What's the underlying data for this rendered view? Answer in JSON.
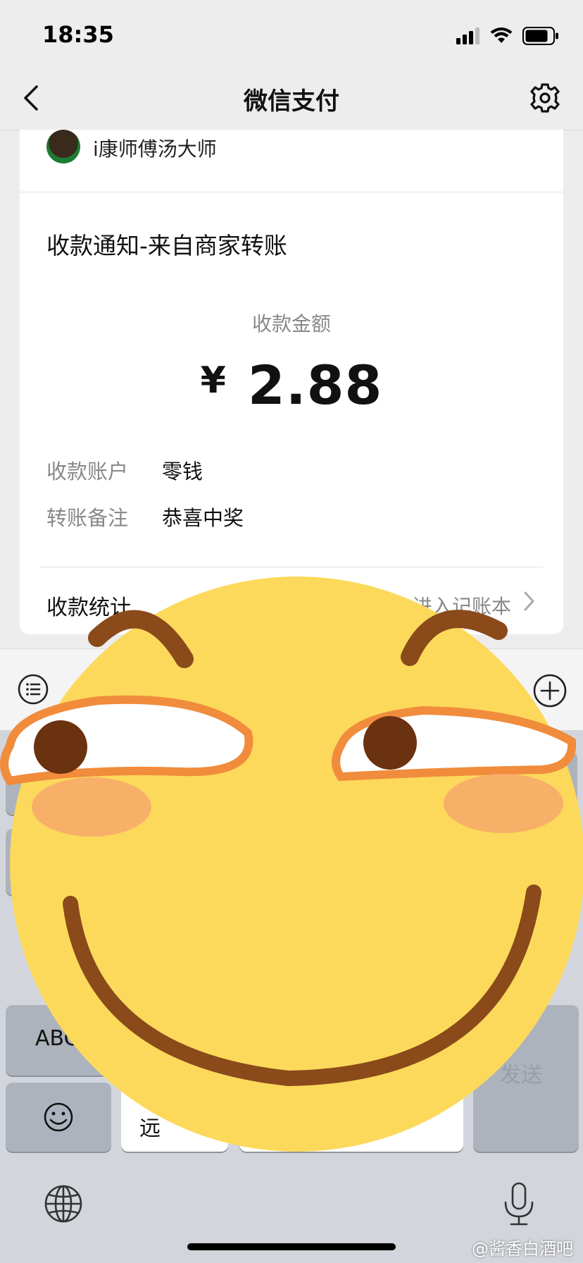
{
  "status_bar": {
    "time": "18:35"
  },
  "nav": {
    "title": "微信支付"
  },
  "merchant": {
    "name": "i康师傅汤大师"
  },
  "notice": {
    "title": "收款通知-来自商家转账",
    "amount_label": "收款金额",
    "currency": "¥",
    "amount": "2.88"
  },
  "details": [
    {
      "label": "收款账户",
      "value": "零钱"
    },
    {
      "label": "转账备注",
      "value": "恭喜中奖"
    }
  ],
  "stats": {
    "label": "收款统计",
    "link": "进入记账本"
  },
  "keyboard": {
    "abc_label": "ABC",
    "send_label": "发送",
    "candidate": "远"
  },
  "watermark": "@酱香白酒吧",
  "colors": {
    "sticker_face": "#fcd95b",
    "sticker_brown": "#8a4a1a",
    "sticker_blush": "#f7a86b"
  }
}
